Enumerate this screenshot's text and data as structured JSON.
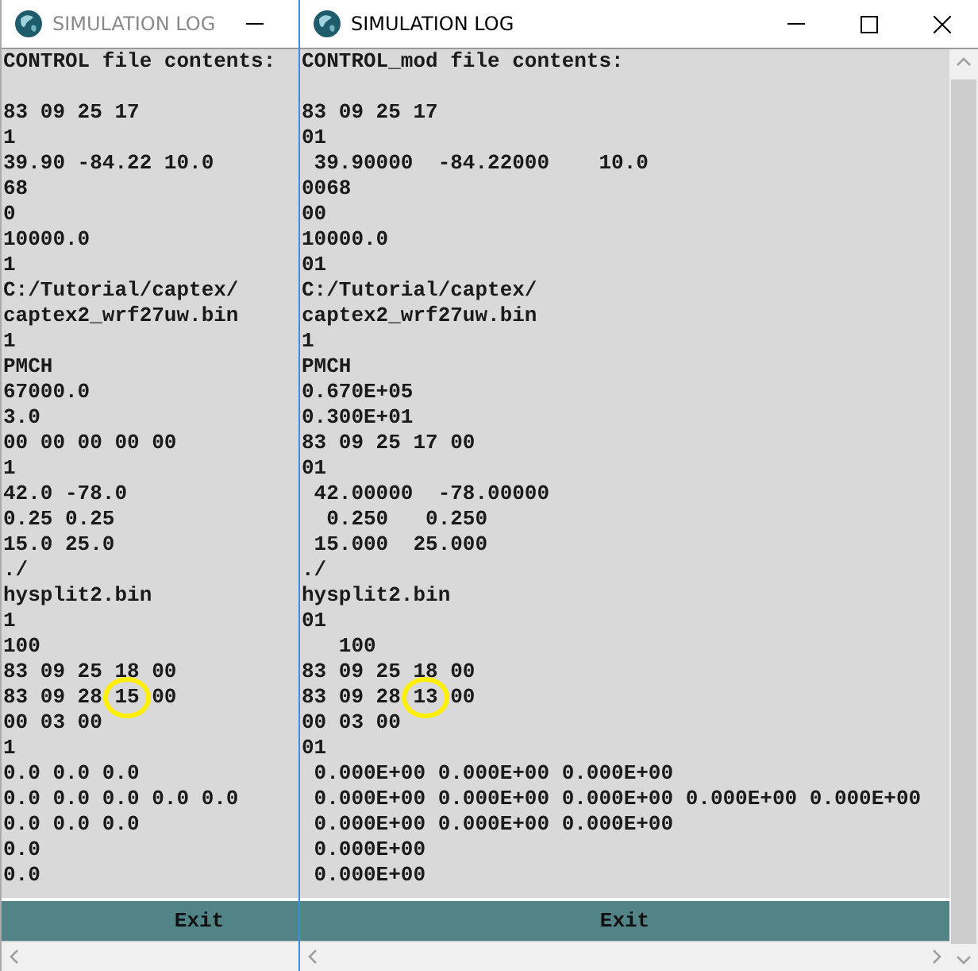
{
  "windows": [
    {
      "title": "SIMULATION LOG",
      "active": false,
      "vertical_scrollbar": false,
      "title_buttons": [
        {
          "kind": "minimize"
        }
      ],
      "exit_label": "Exit",
      "lines": [
        {
          "kind": "text",
          "text": "CONTROL file contents:"
        },
        {
          "kind": "blank"
        },
        {
          "kind": "text",
          "text": "83 09 25 17"
        },
        {
          "kind": "text",
          "text": "1"
        },
        {
          "kind": "text",
          "text": "39.90 -84.22 10.0"
        },
        {
          "kind": "text",
          "text": "68"
        },
        {
          "kind": "text",
          "text": "0"
        },
        {
          "kind": "text",
          "text": "10000.0"
        },
        {
          "kind": "text",
          "text": "1"
        },
        {
          "kind": "text",
          "text": "C:/Tutorial/captex/"
        },
        {
          "kind": "text",
          "text": "captex2_wrf27uw.bin"
        },
        {
          "kind": "text",
          "text": "1"
        },
        {
          "kind": "text",
          "text": "PMCH"
        },
        {
          "kind": "text",
          "text": "67000.0"
        },
        {
          "kind": "text",
          "text": "3.0"
        },
        {
          "kind": "text",
          "text": "00 00 00 00 00"
        },
        {
          "kind": "text",
          "text": "1"
        },
        {
          "kind": "text",
          "text": "42.0 -78.0"
        },
        {
          "kind": "text",
          "text": "0.25 0.25"
        },
        {
          "kind": "text",
          "text": "15.0 25.0"
        },
        {
          "kind": "text",
          "text": "./"
        },
        {
          "kind": "text",
          "text": "hysplit2.bin"
        },
        {
          "kind": "text",
          "text": "1"
        },
        {
          "kind": "text",
          "text": "100"
        },
        {
          "kind": "text",
          "text": "83 09 25 18 00"
        },
        {
          "kind": "circled",
          "before": "83 09 28 ",
          "circled": "15",
          "after": " 00"
        },
        {
          "kind": "text",
          "text": "00 03 00"
        },
        {
          "kind": "text",
          "text": "1"
        },
        {
          "kind": "text",
          "text": "0.0 0.0 0.0"
        },
        {
          "kind": "text",
          "text": "0.0 0.0 0.0 0.0 0.0"
        },
        {
          "kind": "text",
          "text": "0.0 0.0 0.0"
        },
        {
          "kind": "text",
          "text": "0.0"
        },
        {
          "kind": "text",
          "text": "0.0"
        }
      ]
    },
    {
      "title": "SIMULATION LOG",
      "active": true,
      "vertical_scrollbar": true,
      "title_buttons": [
        {
          "kind": "minimize"
        },
        {
          "kind": "maximize"
        },
        {
          "kind": "close"
        }
      ],
      "exit_label": "Exit",
      "lines": [
        {
          "kind": "text",
          "text": "CONTROL_mod file contents:"
        },
        {
          "kind": "blank"
        },
        {
          "kind": "text",
          "text": "83 09 25 17"
        },
        {
          "kind": "text",
          "text": "01"
        },
        {
          "kind": "text",
          "text": " 39.90000  -84.22000    10.0"
        },
        {
          "kind": "text",
          "text": "0068"
        },
        {
          "kind": "text",
          "text": "00"
        },
        {
          "kind": "text",
          "text": "10000.0"
        },
        {
          "kind": "text",
          "text": "01"
        },
        {
          "kind": "text",
          "text": "C:/Tutorial/captex/"
        },
        {
          "kind": "text",
          "text": "captex2_wrf27uw.bin"
        },
        {
          "kind": "text",
          "text": "1"
        },
        {
          "kind": "text",
          "text": "PMCH"
        },
        {
          "kind": "text",
          "text": "0.670E+05"
        },
        {
          "kind": "text",
          "text": "0.300E+01"
        },
        {
          "kind": "text",
          "text": "83 09 25 17 00"
        },
        {
          "kind": "text",
          "text": "01"
        },
        {
          "kind": "text",
          "text": " 42.00000  -78.00000"
        },
        {
          "kind": "text",
          "text": "  0.250   0.250"
        },
        {
          "kind": "text",
          "text": " 15.000  25.000"
        },
        {
          "kind": "text",
          "text": "./"
        },
        {
          "kind": "text",
          "text": "hysplit2.bin"
        },
        {
          "kind": "text",
          "text": "01"
        },
        {
          "kind": "text",
          "text": "   100"
        },
        {
          "kind": "text",
          "text": "83 09 25 18 00"
        },
        {
          "kind": "circled",
          "before": "83 09 28 ",
          "circled": "13",
          "after": " 00"
        },
        {
          "kind": "text",
          "text": "00 03 00"
        },
        {
          "kind": "text",
          "text": "01"
        },
        {
          "kind": "text",
          "text": " 0.000E+00 0.000E+00 0.000E+00"
        },
        {
          "kind": "text",
          "text": " 0.000E+00 0.000E+00 0.000E+00 0.000E+00 0.000E+00"
        },
        {
          "kind": "text",
          "text": " 0.000E+00 0.000E+00 0.000E+00"
        },
        {
          "kind": "text",
          "text": " 0.000E+00"
        },
        {
          "kind": "text",
          "text": " 0.000E+00"
        }
      ]
    }
  ]
}
